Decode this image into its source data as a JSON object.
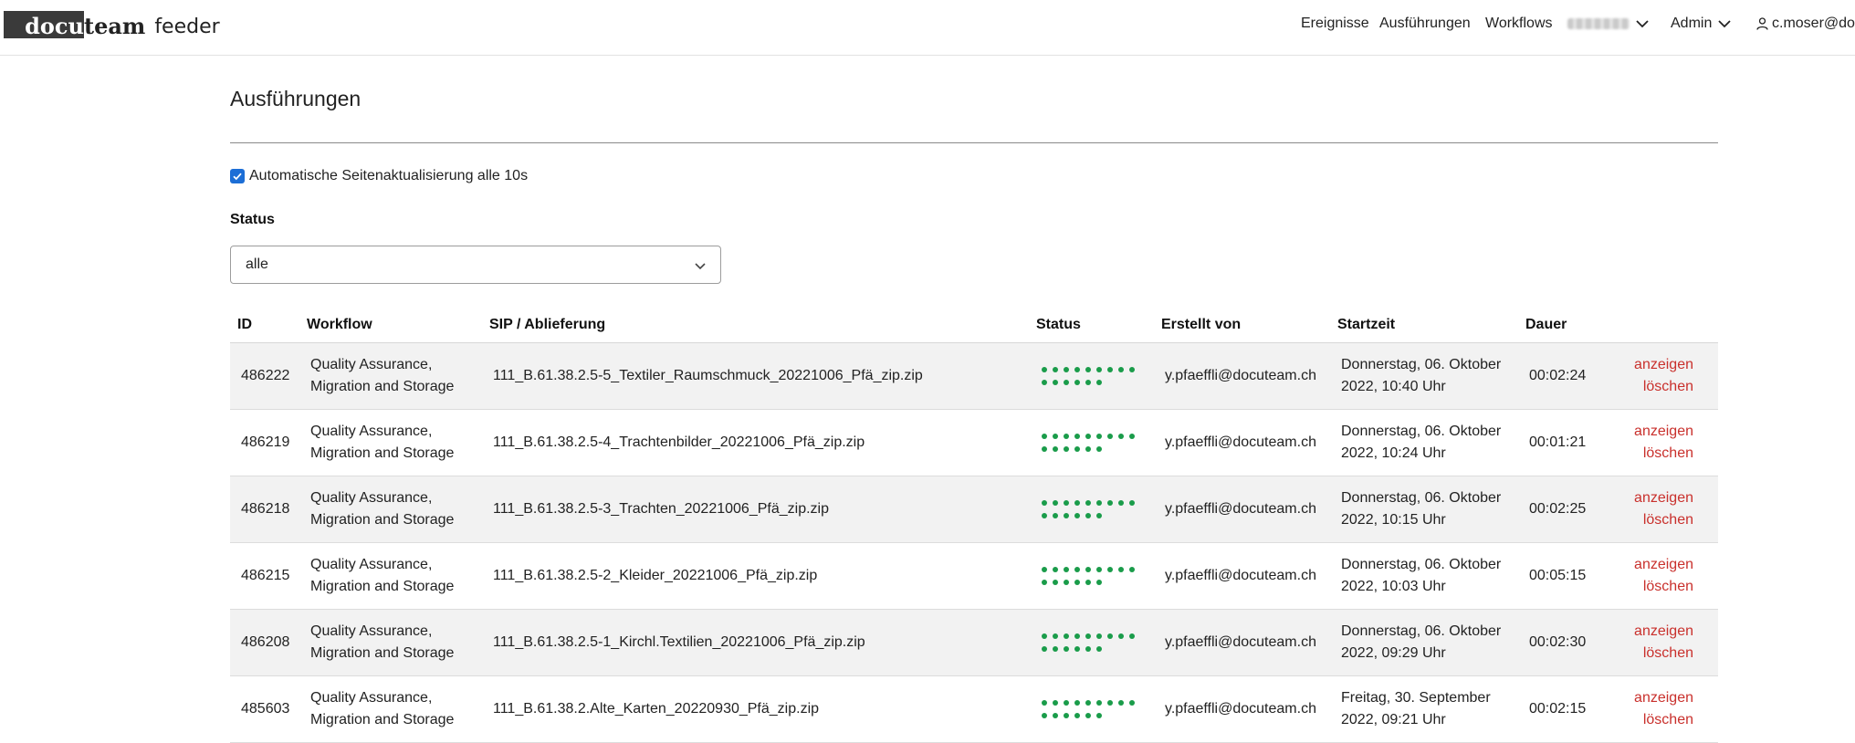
{
  "brand": {
    "part1": "docu",
    "part2": "team",
    "part3": "feeder"
  },
  "nav": {
    "events": "Ereignisse",
    "executions": "Ausführungen",
    "workflows": "Workflows",
    "admin": "Admin",
    "user": "c.moser@do"
  },
  "page": {
    "title": "Ausführungen",
    "auto_refresh_label": "Automatische Seitenaktualisierung alle 10s",
    "auto_refresh_checked": true,
    "status_label": "Status",
    "status_value": "alle"
  },
  "table": {
    "headers": {
      "id": "ID",
      "workflow": "Workflow",
      "sip": "SIP / Ablieferung",
      "status": "Status",
      "created_by": "Erstellt von",
      "start": "Startzeit",
      "duration": "Dauer"
    },
    "action_show": "anzeigen",
    "action_delete": "löschen",
    "status_color": "#1a9c4a",
    "rows": [
      {
        "id": "486222",
        "workflow_l1": "Quality Assurance,",
        "workflow_l2": "Migration and Storage",
        "sip": "111_B.61.38.2.5-5_Textiler_Raumschmuck_20221006_Pfä_zip.zip",
        "created_by": "y.pfaeffli@docuteam.ch",
        "start_l1": "Donnerstag, 06. Oktober",
        "start_l2": "2022, 10:40 Uhr",
        "duration": "00:02:24"
      },
      {
        "id": "486219",
        "workflow_l1": "Quality Assurance,",
        "workflow_l2": "Migration and Storage",
        "sip": "111_B.61.38.2.5-4_Trachtenbilder_20221006_Pfä_zip.zip",
        "created_by": "y.pfaeffli@docuteam.ch",
        "start_l1": "Donnerstag, 06. Oktober",
        "start_l2": "2022, 10:24 Uhr",
        "duration": "00:01:21"
      },
      {
        "id": "486218",
        "workflow_l1": "Quality Assurance,",
        "workflow_l2": "Migration and Storage",
        "sip": "111_B.61.38.2.5-3_Trachten_20221006_Pfä_zip.zip",
        "created_by": "y.pfaeffli@docuteam.ch",
        "start_l1": "Donnerstag, 06. Oktober",
        "start_l2": "2022, 10:15 Uhr",
        "duration": "00:02:25"
      },
      {
        "id": "486215",
        "workflow_l1": "Quality Assurance,",
        "workflow_l2": "Migration and Storage",
        "sip": "111_B.61.38.2.5-2_Kleider_20221006_Pfä_zip.zip",
        "created_by": "y.pfaeffli@docuteam.ch",
        "start_l1": "Donnerstag, 06. Oktober",
        "start_l2": "2022, 10:03 Uhr",
        "duration": "00:05:15"
      },
      {
        "id": "486208",
        "workflow_l1": "Quality Assurance,",
        "workflow_l2": "Migration and Storage",
        "sip": "111_B.61.38.2.5-1_Kirchl.Textilien_20221006_Pfä_zip.zip",
        "created_by": "y.pfaeffli@docuteam.ch",
        "start_l1": "Donnerstag, 06. Oktober",
        "start_l2": "2022, 09:29 Uhr",
        "duration": "00:02:30"
      },
      {
        "id": "485603",
        "workflow_l1": "Quality Assurance,",
        "workflow_l2": "Migration and Storage",
        "sip": "111_B.61.38.2.Alte_Karten_20220930_Pfä_zip.zip",
        "created_by": "y.pfaeffli@docuteam.ch",
        "start_l1": "Freitag, 30. September",
        "start_l2": "2022, 09:21 Uhr",
        "duration": "00:02:15"
      }
    ]
  }
}
